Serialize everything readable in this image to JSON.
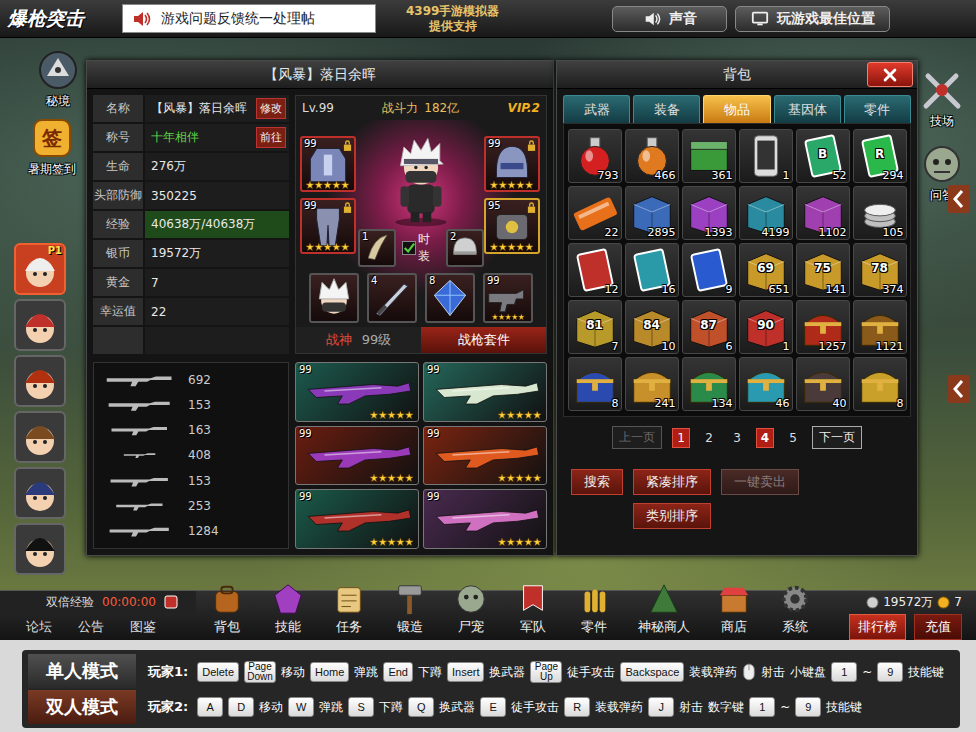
{
  "header": {
    "logo": "爆枪突击",
    "notice": "游戏问题反馈统一处理帖",
    "sponsor": [
      "4399手游模拟器",
      "提供支持"
    ],
    "buttons": [
      {
        "label": "声音"
      },
      {
        "label": "玩游戏最佳位置"
      }
    ]
  },
  "scene_icons": [
    {
      "label": "秘境",
      "badge": ""
    },
    {
      "label": "暑期签到",
      "badge": "签"
    },
    {
      "label": "技场",
      "badge": ""
    },
    {
      "label": "问答",
      "badge": ""
    }
  ],
  "roster": [
    {
      "badge": "P1",
      "selected": true
    },
    {
      "badge": "",
      "selected": false
    },
    {
      "badge": "",
      "selected": false
    },
    {
      "badge": "",
      "selected": false
    },
    {
      "badge": "",
      "selected": false
    },
    {
      "badge": "",
      "selected": false
    }
  ],
  "character": {
    "title": "【风暴】落日余晖",
    "stats": [
      {
        "label": "名称",
        "value": "【风暴】落日余晖",
        "button": "修改",
        "color": "#e8e8e8"
      },
      {
        "label": "称号",
        "value": "十年相伴",
        "button": "前往",
        "color": "#5fd44a"
      },
      {
        "label": "生命",
        "value": "276万",
        "color": "#e8e8e8"
      },
      {
        "label": "头部防御",
        "value": "350225",
        "color": "#e8e8e8"
      },
      {
        "label": "经验",
        "value": "40638万/40638万",
        "color": "#e8e8e8",
        "level": 1
      },
      {
        "label": "银币",
        "value": "19572万",
        "color": "#e8e8e8"
      },
      {
        "label": "黄金",
        "value": "7",
        "color": "#e8e8e8"
      },
      {
        "label": "幸运值",
        "value": "22",
        "color": "#e8e8e8"
      },
      {
        "label": "",
        "value": "",
        "color": "#e8e8e8"
      }
    ],
    "level": "Lv.99",
    "power_label": "战斗力",
    "power": "182亿",
    "vip": "VIP.2",
    "equipment": [
      {
        "kind": "armor",
        "level": "99",
        "stars": 5,
        "locked": true,
        "color": "#c0302a"
      },
      {
        "kind": "legs",
        "level": "99",
        "stars": 5,
        "locked": true,
        "color": "#c0302a"
      },
      {
        "kind": "helmet",
        "level": "99",
        "stars": 5,
        "locked": true,
        "color": "#c0302a"
      },
      {
        "kind": "mech",
        "level": "95",
        "stars": 5,
        "locked": true,
        "color": "#d4a52a"
      },
      {
        "kind": "horn",
        "level": "1",
        "stars": 0,
        "locked": false,
        "color": "#555555"
      },
      {
        "kind": "cap",
        "level": "2",
        "stars": 0,
        "locked": false,
        "color": "#555555"
      },
      {
        "kind": "portrait",
        "level": "",
        "stars": 0,
        "locked": false,
        "color": "#555555"
      },
      {
        "kind": "sword",
        "level": "4",
        "stars": 0,
        "locked": false,
        "color": "#555555"
      },
      {
        "kind": "gem",
        "level": "8",
        "stars": 0,
        "locked": false,
        "color": "#555555"
      },
      {
        "kind": "gun",
        "level": "99",
        "stars": 5,
        "locked": false,
        "color": "#555555"
      }
    ],
    "fashion": {
      "label": "时装",
      "checked": true
    },
    "tabs": [
      {
        "label": "战神",
        "value": "99级",
        "selected": true
      },
      {
        "label": "战枪套件",
        "selected": false
      }
    ],
    "weapon_counts": [
      "692",
      "153",
      "163",
      "408",
      "153",
      "253",
      "1284"
    ],
    "weapons": [
      {
        "level": "99",
        "stars": 5,
        "color": "#1c5a4e"
      },
      {
        "level": "99",
        "stars": 5,
        "color": "#24665a"
      },
      {
        "level": "99",
        "stars": 5,
        "color": "#6a1d10"
      },
      {
        "level": "99",
        "stars": 5,
        "color": "#7a2410"
      },
      {
        "level": "99",
        "stars": 5,
        "color": "#1a5a4a"
      },
      {
        "level": "99",
        "stars": 5,
        "color": "#4a2a50"
      }
    ]
  },
  "bag": {
    "title": "背包",
    "tabs": [
      {
        "label": "武器",
        "selected": false
      },
      {
        "label": "装备",
        "selected": false
      },
      {
        "label": "物品",
        "selected": true
      },
      {
        "label": "基因体",
        "selected": false
      },
      {
        "label": "零件",
        "selected": false
      }
    ],
    "items": [
      {
        "kind": "potion",
        "color": "#d42020",
        "label": "",
        "count": "793"
      },
      {
        "kind": "potion",
        "color": "#e07a20",
        "label": "",
        "count": "466"
      },
      {
        "kind": "crate",
        "color": "#3a9a3a",
        "label": "",
        "count": "361"
      },
      {
        "kind": "phone",
        "color": "#dddddd",
        "label": "",
        "count": "1"
      },
      {
        "kind": "card",
        "color": "#2aa86a",
        "label": "B",
        "count": "52"
      },
      {
        "kind": "card",
        "color": "#2ab84a",
        "label": "R",
        "count": "294"
      },
      {
        "kind": "ticket",
        "color": "#e8701a",
        "label": "",
        "count": "22"
      },
      {
        "kind": "box",
        "color": "#3a6ab8",
        "label": "",
        "count": "2895"
      },
      {
        "kind": "box",
        "color": "#9a40c0",
        "label": "",
        "count": "1393"
      },
      {
        "kind": "box",
        "color": "#2a8aa0",
        "label": "",
        "count": "4199"
      },
      {
        "kind": "box",
        "color": "#a040b0",
        "label": "",
        "count": "1102"
      },
      {
        "kind": "coin",
        "color": "#c0c0c0",
        "label": "",
        "count": "105"
      },
      {
        "kind": "card",
        "color": "#c0302a",
        "label": "",
        "count": "12"
      },
      {
        "kind": "card",
        "color": "#2a9aa8",
        "label": "",
        "count": "16"
      },
      {
        "kind": "card",
        "color": "#2a5ad0",
        "label": "",
        "count": "9"
      },
      {
        "kind": "box",
        "color": "#c89a2a",
        "label": "69",
        "count": "651"
      },
      {
        "kind": "box",
        "color": "#c89a2a",
        "label": "75",
        "count": "141"
      },
      {
        "kind": "box",
        "color": "#c89a2a",
        "label": "78",
        "count": "374"
      },
      {
        "kind": "box",
        "color": "#b89a2a",
        "label": "81",
        "count": "7"
      },
      {
        "kind": "box",
        "color": "#b88a2a",
        "label": "84",
        "count": "10"
      },
      {
        "kind": "box",
        "color": "#c0502a",
        "label": "87",
        "count": "6"
      },
      {
        "kind": "box",
        "color": "#c0302a",
        "label": "90",
        "count": "1"
      },
      {
        "kind": "chest",
        "color": "#b02a1a",
        "label": "",
        "count": "1257"
      },
      {
        "kind": "chest",
        "color": "#8a5a1a",
        "label": "",
        "count": "1121"
      },
      {
        "kind": "chest",
        "color": "#2a4ab0",
        "label": "",
        "count": "8"
      },
      {
        "kind": "chest",
        "color": "#c8902a",
        "label": "",
        "count": "241"
      },
      {
        "kind": "chest",
        "color": "#2a8a4a",
        "label": "",
        "count": "134"
      },
      {
        "kind": "chest",
        "color": "#2a9ab0",
        "label": "",
        "count": "46"
      },
      {
        "kind": "chest",
        "color": "#4a3a3a",
        "label": "",
        "count": "40"
      },
      {
        "kind": "chest",
        "color": "#c8a02a",
        "label": "",
        "count": "8"
      }
    ],
    "pagination": {
      "prev": {
        "label": "上一页",
        "disabled": true
      },
      "pages": [
        {
          "label": "1",
          "selected": false,
          "marked": true
        },
        {
          "label": "2",
          "selected": false,
          "marked": false
        },
        {
          "label": "3",
          "selected": false,
          "marked": false
        },
        {
          "label": "4",
          "selected": true,
          "marked": true
        },
        {
          "label": "5",
          "selected": false,
          "marked": false
        }
      ],
      "next": {
        "label": "下一页",
        "disabled": false
      }
    },
    "buttons": [
      {
        "label": "搜索",
        "disabled": false
      },
      {
        "label": "紧凑排序",
        "disabled": false
      },
      {
        "label": "一键卖出",
        "disabled": true
      },
      {
        "label": "类别排序",
        "disabled": false
      }
    ]
  },
  "menu_bar": {
    "double_exp": "双倍经验",
    "timer": "00:00:00",
    "links": [
      "论坛",
      "公告",
      "图鉴"
    ],
    "items": [
      "背包",
      "技能",
      "任务",
      "锻造",
      "尸宠",
      "军队",
      "零件",
      "神秘商人",
      "商店",
      "系统"
    ],
    "silver": "19572万",
    "gold": "7",
    "rank": "排行榜",
    "recharge": "充值"
  },
  "controls": {
    "modes": [
      {
        "label": "单人模式",
        "selected": false
      },
      {
        "label": "双人模式",
        "selected": true
      }
    ],
    "players": [
      {
        "label": "玩家1:",
        "items": [
          {
            "kind": "key",
            "text": "Delete"
          },
          {
            "kind": "key",
            "text": "Page Down"
          },
          {
            "kind": "label",
            "text": "移动"
          },
          {
            "kind": "key",
            "text": "Home"
          },
          {
            "kind": "label",
            "text": "弹跳"
          },
          {
            "kind": "key",
            "text": "End"
          },
          {
            "kind": "label",
            "text": "下蹲"
          },
          {
            "kind": "key",
            "text": "Insert"
          },
          {
            "kind": "label",
            "text": "换武器"
          },
          {
            "kind": "key",
            "text": "Page Up"
          },
          {
            "kind": "label",
            "text": "徒手攻击"
          },
          {
            "kind": "key",
            "text": "Backspace"
          },
          {
            "kind": "label",
            "text": "装载弹药"
          },
          {
            "kind": "mouse"
          },
          {
            "kind": "label",
            "text": "射击"
          },
          {
            "kind": "label",
            "text": "小键盘"
          },
          {
            "kind": "key",
            "text": "1"
          },
          {
            "kind": "label",
            "text": "~"
          },
          {
            "kind": "key",
            "text": "9"
          },
          {
            "kind": "label",
            "text": "技能键"
          }
        ]
      },
      {
        "label": "玩家2:",
        "items": [
          {
            "kind": "key",
            "text": "A"
          },
          {
            "kind": "key",
            "text": "D"
          },
          {
            "kind": "label",
            "text": "移动"
          },
          {
            "kind": "key",
            "text": "W"
          },
          {
            "kind": "label",
            "text": "弹跳"
          },
          {
            "kind": "key",
            "text": "S"
          },
          {
            "kind": "label",
            "text": "下蹲"
          },
          {
            "kind": "key",
            "text": "Q"
          },
          {
            "kind": "label",
            "text": "换武器"
          },
          {
            "kind": "key",
            "text": "E"
          },
          {
            "kind": "label",
            "text": "徒手攻击"
          },
          {
            "kind": "key",
            "text": "R"
          },
          {
            "kind": "label",
            "text": "装载弹药"
          },
          {
            "kind": "key",
            "text": "J"
          },
          {
            "kind": "label",
            "text": "射击"
          },
          {
            "kind": "label",
            "text": "数字键"
          },
          {
            "kind": "key",
            "text": "1"
          },
          {
            "kind": "label",
            "text": "~"
          },
          {
            "kind": "key",
            "text": "9"
          },
          {
            "kind": "label",
            "text": "技能键"
          }
        ]
      }
    ]
  }
}
